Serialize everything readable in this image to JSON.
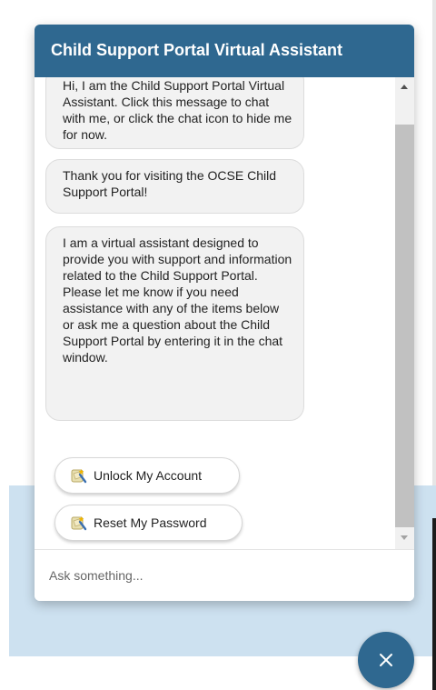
{
  "header": {
    "title": "Child Support Portal Virtual Assistant"
  },
  "messages": [
    {
      "text": "Hi, I am the Child Support Portal Virtual Assistant. Click this message to chat with me, or click the chat icon to hide me for now."
    },
    {
      "text": "Thank you for visiting the OCSE Child Support Portal!"
    },
    {
      "text": "I am a virtual assistant designed to provide you with support and information related to the Child Support Portal. Please let me know if you need assistance with any of the items below or ask me a question about the Child Support Portal by entering it in the chat window."
    }
  ],
  "actions": [
    {
      "label": "Unlock My Account",
      "icon": "wizard-icon"
    },
    {
      "label": "Reset My Password",
      "icon": "wizard-icon"
    }
  ],
  "input": {
    "placeholder": "Ask something...",
    "value": ""
  },
  "fab": {
    "icon": "close-icon"
  },
  "colors": {
    "brand": "#2f6890",
    "bubble": "#f2f2f2",
    "backdrop": "#cde1f0"
  }
}
